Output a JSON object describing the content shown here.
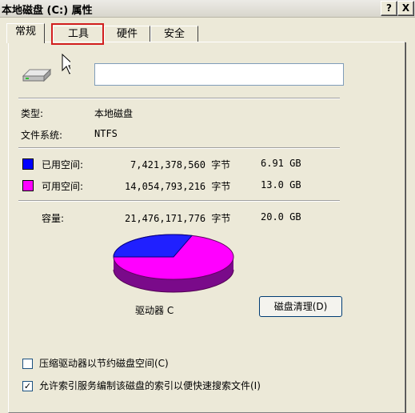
{
  "window": {
    "title": "本地磁盘 (C:) 属性",
    "help_button": "?",
    "close_button": "X"
  },
  "tabs": [
    "常规",
    "工具",
    "硬件",
    "安全"
  ],
  "general": {
    "volume_label_value": "",
    "type_label": "类型:",
    "type_value": "本地磁盘",
    "fs_label": "文件系统:",
    "fs_value": "NTFS",
    "used": {
      "label": "已用空间:",
      "bytes": "7,421,378,560 字节",
      "size": "6.91 GB",
      "color": "#0000ff"
    },
    "free": {
      "label": "可用空间:",
      "bytes": "14,054,793,216 字节",
      "size": "13.0 GB",
      "color": "#ff00ff"
    },
    "capacity": {
      "label": "容量:",
      "bytes": "21,476,171,776 字节",
      "size": "20.0 GB"
    },
    "drive_label": "驱动器 C",
    "cleanup_button": "磁盘清理(D)",
    "compress_checkbox": {
      "label": "压缩驱动器以节约磁盘空间(C)",
      "checked": false
    },
    "index_checkbox": {
      "label": "允许索引服务编制该磁盘的索引以便快速搜索文件(I)",
      "checked": true,
      "mark": "✓"
    }
  }
}
